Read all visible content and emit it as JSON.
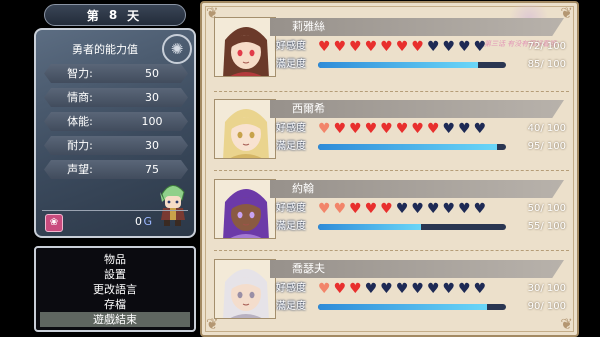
{
  "day": {
    "prefix": "第",
    "number": "8",
    "suffix": "天"
  },
  "stats": {
    "title": "勇者的能力值",
    "rows": [
      {
        "label": "智力:",
        "value": "50"
      },
      {
        "label": "情商:",
        "value": "30"
      },
      {
        "label": "体能:",
        "value": "100"
      },
      {
        "label": "耐力:",
        "value": "30"
      },
      {
        "label": "声望:",
        "value": "75"
      }
    ],
    "gold": "0",
    "gold_unit": "G"
  },
  "menu": {
    "items": [
      "物品",
      "設置",
      "更改語言",
      "存檔",
      "遊戲結束"
    ],
    "selected": 4
  },
  "watermark": "第三话 有没有很好看哦~",
  "characters": [
    {
      "name": "莉雅絲",
      "affection_label": "好感度",
      "affection": "72/ 100",
      "hearts": [
        1,
        1,
        1,
        1,
        1,
        1,
        1,
        0,
        0,
        0,
        0
      ],
      "satisfaction_label": "滿足度",
      "satisfaction": "85/ 100",
      "satisfaction_fraction": 0.85,
      "hair": "#6b3a2a",
      "skin": "#f6dcc8",
      "accent": "#e23b4a"
    },
    {
      "name": "西爾希",
      "affection_label": "好感度",
      "affection": "40/ 100",
      "hearts": [
        2,
        1,
        1,
        1,
        1,
        1,
        1,
        1,
        0,
        0,
        0
      ],
      "satisfaction_label": "滿足度",
      "satisfaction": "95/ 100",
      "satisfaction_fraction": 0.95,
      "hair": "#ead48e",
      "skin": "#f8e2d0",
      "accent": "#c7a24a"
    },
    {
      "name": "約翰",
      "affection_label": "好感度",
      "affection": "50/ 100",
      "hearts": [
        2,
        2,
        1,
        1,
        1,
        0,
        0,
        0,
        0,
        0,
        0
      ],
      "satisfaction_label": "滿足度",
      "satisfaction": "55/ 100",
      "satisfaction_fraction": 0.55,
      "hair": "#6c3aa8",
      "skin": "#8a5a42",
      "accent": "#c9a3f2"
    },
    {
      "name": "喬瑟夫",
      "affection_label": "好感度",
      "affection": "30/ 100",
      "hearts": [
        2,
        1,
        1,
        0,
        0,
        0,
        0,
        0,
        0,
        0,
        0
      ],
      "satisfaction_label": "滿足度",
      "satisfaction": "90/ 100",
      "satisfaction_fraction": 0.9,
      "hair": "#e6e3e8",
      "skin": "#f4ddcc",
      "accent": "#9a8fa6"
    }
  ],
  "colors": {
    "heart_on": "#e8302e",
    "heart_off": "#1e2a55",
    "bar_fill": "#48a8e8"
  }
}
